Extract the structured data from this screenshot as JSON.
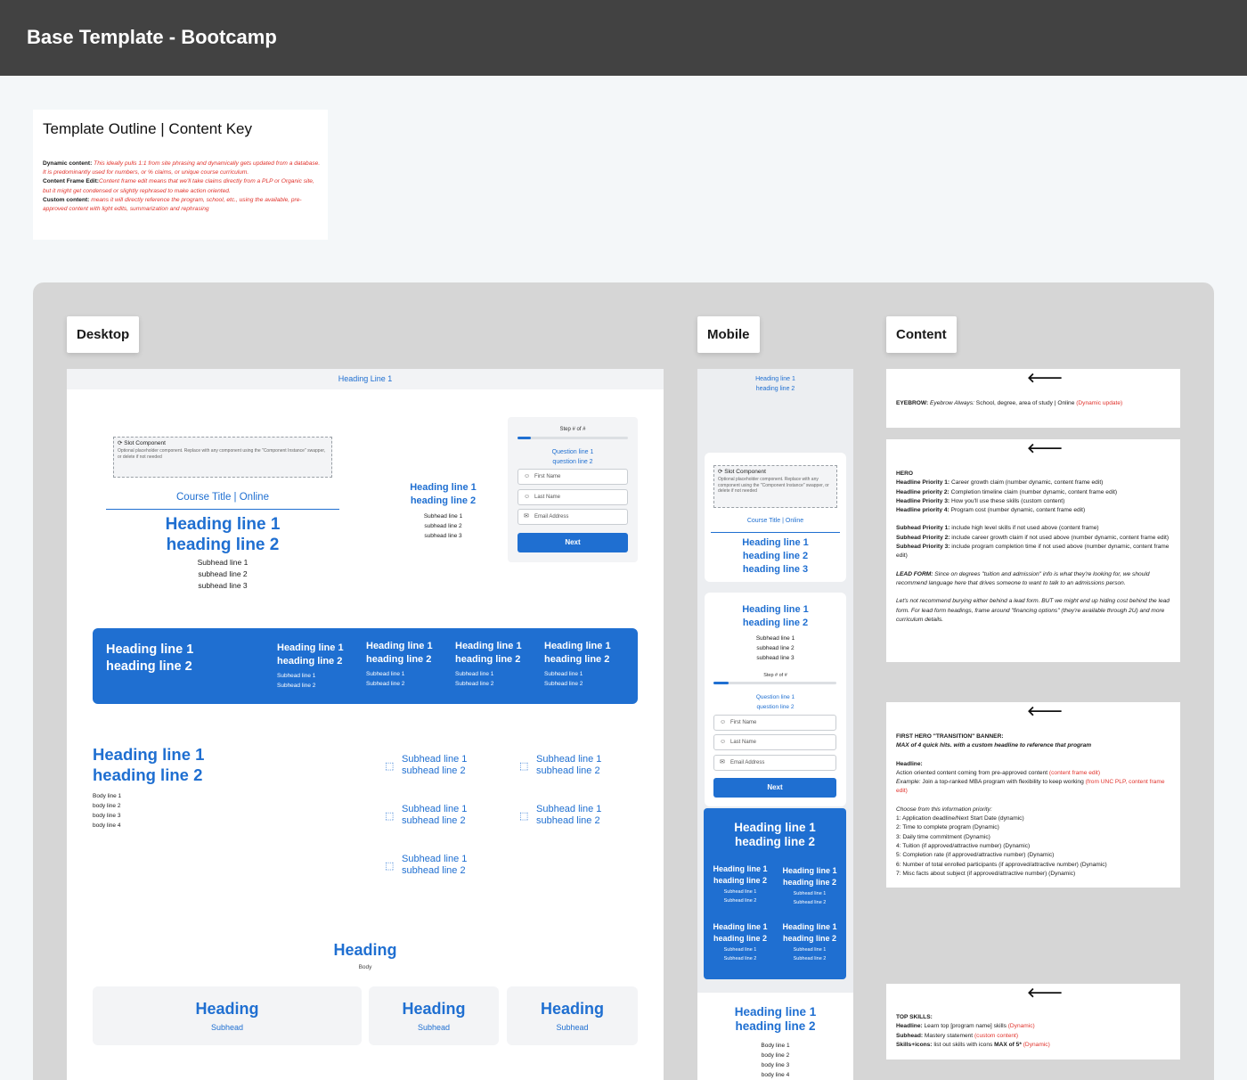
{
  "header": {
    "title": "Base Template - Bootcamp"
  },
  "outline": {
    "title": "Template Outline | Content Key",
    "dynamic_label": "Dynamic content:",
    "dynamic_text": "This ideally pulls 1:1 from site phrasing and dynamically gets updated from a database. It is predominantly used for numbers, or % claims, or unique course curriculum.",
    "frame_label": "Content Frame Edit:",
    "frame_text": "Content frame edit means that we'll take claims directly from a PLP or Organic site, but it might get condensed or slightly rephrased to make action oriented.",
    "custom_label": "Custom content:",
    "custom_text": "means it will directly reference the program, school, etc., using the available, pre-approved content with light edits, summarization and  rephrasing"
  },
  "labels": {
    "desktop": "Desktop",
    "mobile": "Mobile",
    "content": "Content"
  },
  "desktop": {
    "top_heading": "Heading Line 1",
    "slot_title": "Slot Component",
    "slot_desc": "Optional placeholder component. Replace with any component using the \"Component Instance\" swapper, or delete if not needed",
    "course_title": "Course Title | Online",
    "hero_h1": "Heading line 1",
    "hero_h2": "heading line 2",
    "hero_s1": "Subhead line 1",
    "hero_s2": "subhead line 2",
    "hero_s3": "subhead line 3",
    "side_h1": "Heading line 1",
    "side_h2": "heading line 2",
    "side_s1": "Subhead line 1",
    "side_s2": "subhead line 2",
    "side_s3": "subhead line 3",
    "form": {
      "step": "Step # of #",
      "q1": "Question line 1",
      "q2": "question line 2",
      "first": "First Name",
      "last": "Last Name",
      "email": "Email Address",
      "next": "Next",
      "progress": 0.12
    },
    "banner": {
      "h1": "Heading line 1",
      "h2": "heading line 2",
      "items": [
        {
          "h1": "Heading line 1",
          "h2": "heading line 2",
          "s1": "Subhead line 1",
          "s2": "Subhead line 2"
        },
        {
          "h1": "Heading line 1",
          "h2": "heading line 2",
          "s1": "Subhead line 1",
          "s2": "Subhead line 2"
        },
        {
          "h1": "Heading line 1",
          "h2": "heading line 2",
          "s1": "Subhead line 1",
          "s2": "Subhead line 2"
        },
        {
          "h1": "Heading line 1",
          "h2": "heading line 2",
          "s1": "Subhead line 1",
          "s2": "Subhead line 2"
        }
      ]
    },
    "skills": {
      "h1": "Heading line 1",
      "h2": "heading line 2",
      "body": [
        "Body line 1",
        "body line 2",
        "body line 3",
        "body line 4"
      ],
      "items": [
        {
          "s1": "Subhead line 1",
          "s2": "subhead line 2"
        },
        {
          "s1": "Subhead line 1",
          "s2": "subhead line 2"
        },
        {
          "s1": "Subhead line 1",
          "s2": "subhead line 2"
        },
        {
          "s1": "Subhead line 1",
          "s2": "subhead line 2"
        },
        {
          "s1": "Subhead line 1",
          "s2": "subhead line 2"
        }
      ]
    },
    "section": {
      "heading": "Heading",
      "body": "Body",
      "cards": [
        {
          "h": "Heading",
          "s": "Subhead"
        },
        {
          "h": "Heading",
          "s": "Subhead"
        },
        {
          "h": "Heading",
          "s": "Subhead"
        }
      ]
    }
  },
  "mobile": {
    "top_h1": "Heading line 1",
    "top_h2": "heading line 2",
    "slot_title": "Slot Component",
    "slot_desc": "Optional placeholder component. Replace with any component using the \"Component Instance\" swapper, or delete if not needed",
    "course_title": "Course Title | Online",
    "hero_h1": "Heading line 1",
    "hero_h2": "heading line 2",
    "hero_h3": "heading line 3",
    "card_h1": "Heading line 1",
    "card_h2": "heading line 2",
    "card_s1": "Subhead line 1",
    "card_s2": "subhead line 2",
    "card_s3": "subhead line 3",
    "step": "Step # of #",
    "q1": "Question line 1",
    "q2": "question line 2",
    "first": "First Name",
    "last": "Last Name",
    "email": "Email Address",
    "next": "Next",
    "banner_h1": "Heading line 1",
    "banner_h2": "heading line 2",
    "banner_items": [
      {
        "h1": "Heading line 1",
        "h2": "heading line 2",
        "s1": "Subhead line 1",
        "s2": "Subhead line 2"
      },
      {
        "h1": "Heading line 1",
        "h2": "heading line 2",
        "s1": "Subhead line 1",
        "s2": "Subhead line 2"
      },
      {
        "h1": "Heading line 1",
        "h2": "heading line 2",
        "s1": "Subhead line 1",
        "s2": "Subhead line 2"
      },
      {
        "h1": "Heading line 1",
        "h2": "heading line 2",
        "s1": "Subhead line 1",
        "s2": "Subhead line 2"
      }
    ],
    "skills_h1": "Heading line 1",
    "skills_h2": "heading line 2",
    "skills_body": [
      "Body line 1",
      "body line 2",
      "body line 3",
      "body line 4"
    ]
  },
  "content": {
    "eyebrow": {
      "label": "EYEBROW:",
      "italic": "Eyebrow Always:",
      "text": " School, degree, area of study | Online ",
      "dyn": "(Dynamic update)"
    },
    "hero": {
      "title": "HERO",
      "lines": [
        {
          "b": "Headline Priority 1:",
          "t": " Career growth claim  (number dynamic, content frame edit)"
        },
        {
          "b": "Headline priority 2:",
          "t": " Completion timeline claim (number dynamic, content frame edit)"
        },
        {
          "b": "Headline Priority 3:",
          "t": " How you'll use these skills (custom content)"
        },
        {
          "b": "Headline priority 4:",
          "t": " Program cost (number dynamic, content frame edit)"
        }
      ],
      "sub_lines": [
        {
          "b": "Subhead Priority 1:",
          "t": " include high level skills if not used above (content frame)"
        },
        {
          "b": "Subhead Priority 2:",
          "t": " include career growth claim if not used above (number dynamic, content frame edit)"
        },
        {
          "b": "Subhead Priority 3:",
          "t": " include program completion time if not used above (number dynamic, content frame edit)"
        }
      ],
      "lead_label": "LEAD FORM:",
      "lead_text": " Since on degrees \"tuition and admission\" info is what they're looking for, we should recommend language here that drives someone to want to talk to an admissions person.",
      "lead_note": "Let's not recommend burying either behind a lead form. BUT we might end up hiding cost behind the lead form. For lead form headings, frame around \"financing options\" (they're available through 2U) and more curriculum details."
    },
    "transition": {
      "title": "FIRST HERO \"TRANSITION\" BANNER:",
      "subtitle": "MAX of 4 quick hits. with a custom headline to reference that program",
      "headline_label": "Headline:",
      "headline_text": "Action oriented content coming from pre-approved content ",
      "headline_tag": "(content frame edit)",
      "example_label": "Example:",
      "example_text": " Join a top-ranked MBA program with flexibility to keep working ",
      "example_tag": "(from UNC PLP, content frame edit)",
      "choose": "Choose from this information priority:",
      "list": [
        "1: Application deadline/Next Start Date (dynamic)",
        "2: Time to complete program (Dynamic)",
        "3: Daily time commitment (Dynamic)",
        "4: Tuition (if approved/attractive number) (Dynamic)",
        "5: Completion rate (if approved/attractive number) (Dynamic)",
        "6: Number of total enrolled participants (if approved/attractive number) (Dynamic)",
        "7: Misc facts about subject (if approved/attractive number) (Dynamic)"
      ]
    },
    "top_skills": {
      "title": "TOP SKILLS:",
      "headline_label": "Headline:",
      "headline_text": " Learn top [program name] skills ",
      "headline_tag": "(Dynamic)",
      "subhead_label": "Subhead:",
      "subhead_text": " Mastery statement ",
      "subhead_tag": "(custom content)",
      "skills_label": "Skills+icons:",
      "skills_text": " list out skills with icons ",
      "skills_max": "MAX of 5*",
      "skills_tag": " (Dynamic)"
    }
  },
  "colors": {
    "accent": "#1f6fd1",
    "header_bg": "#424242",
    "canvas_bg": "#d6d6d6",
    "dynamic_red": "#e0322b"
  }
}
